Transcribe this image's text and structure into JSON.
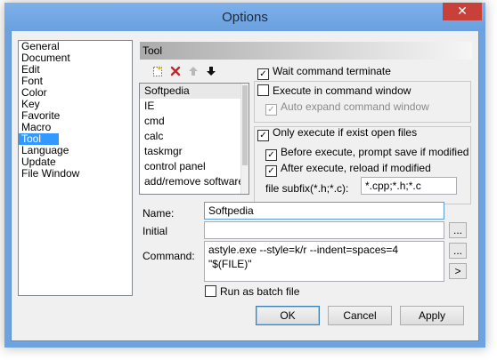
{
  "window": {
    "title": "Options",
    "close_glyph": "✕"
  },
  "categories": [
    "General",
    "Document",
    "Edit",
    "Font",
    "Color",
    "Key",
    "Favorite",
    "Macro",
    "Tool",
    "Language",
    "Update",
    "File Window"
  ],
  "selected_category": "Tool",
  "section_header": "Tool",
  "toolbar": {
    "icons": [
      "new-icon",
      "delete-icon",
      "move-up-icon",
      "move-down-icon"
    ]
  },
  "tools": [
    "Softpedia",
    "IE",
    "cmd",
    "calc",
    "taskmgr",
    "control panel",
    "add/remove software"
  ],
  "options": {
    "wait_command_terminate": {
      "label": "Wait command terminate",
      "checked": true
    },
    "execute_in_command_window": {
      "label": "Execute in command window",
      "checked": false
    },
    "auto_expand_command_window": {
      "label": "Auto expand command window",
      "checked": true,
      "disabled": true
    },
    "only_execute_if_exist_open_files": {
      "label": "Only execute if exist open files",
      "checked": true
    },
    "before_execute_prompt_save": {
      "label": "Before execute, prompt save if modified",
      "checked": true
    },
    "after_execute_reload": {
      "label": "After execute, reload if modified",
      "checked": true
    },
    "file_subfix_label": "file subfix(*.h;*.c):",
    "file_subfix_value": "*.cpp;*.h;*.c"
  },
  "fields": {
    "name_label": "Name:",
    "name_value": "Softpedia",
    "initial_label": "Initial",
    "initial_value": "",
    "command_label": "Command:",
    "command_value": "astyle.exe --style=k/r --indent=spaces=4 \"$(FILE)\"",
    "browse_label": "...",
    "insert_label": ">"
  },
  "run_as_batch": {
    "label": "Run as batch file",
    "checked": false
  },
  "buttons": {
    "ok": "OK",
    "cancel": "Cancel",
    "apply": "Apply"
  },
  "colors": {
    "title_bar": "#6fa3e0",
    "close_button": "#c7403a",
    "selection": "#3399ff"
  }
}
